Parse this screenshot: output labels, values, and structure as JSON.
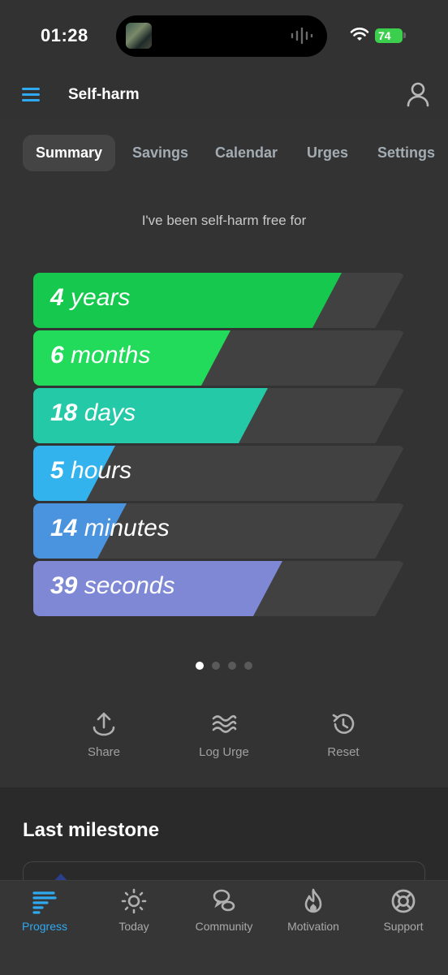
{
  "status": {
    "time": "01:28",
    "battery": "74"
  },
  "header": {
    "title": "Self-harm"
  },
  "tabs": [
    {
      "label": "Summary"
    },
    {
      "label": "Savings"
    },
    {
      "label": "Calendar"
    },
    {
      "label": "Urges"
    },
    {
      "label": "Settings"
    }
  ],
  "summary": {
    "subtitle": "I've been self-harm free for",
    "bars": [
      {
        "value": "4",
        "unit": "years",
        "fill_fraction": 0.83,
        "color": "#16c84e"
      },
      {
        "value": "6",
        "unit": "months",
        "fill_fraction": 0.53,
        "color": "#22db5a"
      },
      {
        "value": "18",
        "unit": "days",
        "fill_fraction": 0.63,
        "color": "#24c9a8"
      },
      {
        "value": "5",
        "unit": "hours",
        "fill_fraction": 0.22,
        "color": "#33b3ee"
      },
      {
        "value": "14",
        "unit": "minutes",
        "fill_fraction": 0.25,
        "color": "#4a93df"
      },
      {
        "value": "39",
        "unit": "seconds",
        "fill_fraction": 0.67,
        "color": "#7e88d4"
      }
    ],
    "page_dots": 4,
    "active_dot": 0
  },
  "actions": [
    {
      "label": "Share",
      "icon": "share-icon"
    },
    {
      "label": "Log Urge",
      "icon": "waves-icon"
    },
    {
      "label": "Reset",
      "icon": "history-icon"
    }
  ],
  "milestone": {
    "title": "Last milestone"
  },
  "tabbar": [
    {
      "label": "Progress",
      "icon": "progress-bars-icon",
      "active": true
    },
    {
      "label": "Today",
      "icon": "sun-icon"
    },
    {
      "label": "Community",
      "icon": "community-icon"
    },
    {
      "label": "Motivation",
      "icon": "flame-icon"
    },
    {
      "label": "Support",
      "icon": "lifebuoy-icon"
    }
  ],
  "colors": {
    "accent": "#2fa9f0",
    "background": "#333333"
  }
}
